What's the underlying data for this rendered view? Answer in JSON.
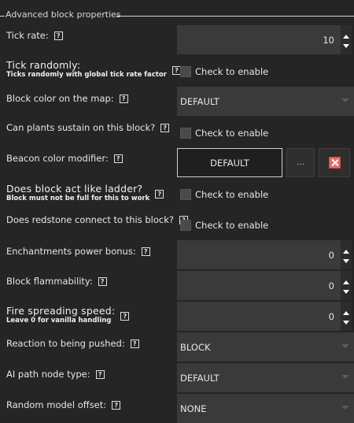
{
  "group": {
    "title": "Advanced block properties"
  },
  "rows": {
    "tick_rate": {
      "label": "Tick rate:",
      "value": "10"
    },
    "tick_randomly": {
      "label": "Tick randomly:",
      "sublabel": "Ticks randomly with global tick rate factor",
      "checkbox_text": "Check to enable"
    },
    "block_color": {
      "label": "Block color on the map:",
      "value": "DEFAULT"
    },
    "plants_sustain": {
      "label": "Can plants sustain on this block?",
      "checkbox_text": "Check to enable"
    },
    "beacon_color": {
      "label": "Beacon color modifier:",
      "value": "DEFAULT",
      "browse": "..."
    },
    "ladder": {
      "label": "Does block act like ladder?",
      "sublabel": "Block must not be full for this to work",
      "checkbox_text": "Check to enable"
    },
    "redstone": {
      "label": "Does redstone connect to this block?",
      "checkbox_text": "Check to enable"
    },
    "enchant_bonus": {
      "label": "Enchantments power bonus:",
      "value": "0"
    },
    "flammability": {
      "label": "Block flammability:",
      "value": "0"
    },
    "fire_spread": {
      "label": "Fire spreading speed:",
      "sublabel": "Leave 0 for vanilla handling",
      "value": "0"
    },
    "pushed": {
      "label": "Reaction to being pushed:",
      "value": "BLOCK"
    },
    "ai_path": {
      "label": "AI path node type:",
      "value": "DEFAULT"
    },
    "model_offset": {
      "label": "Random model offset:",
      "value": "NONE"
    }
  },
  "help_glyph": "?",
  "colors": {
    "background": "#252525",
    "field": "#3a3a3a",
    "clear_button": "#e96a6a"
  }
}
